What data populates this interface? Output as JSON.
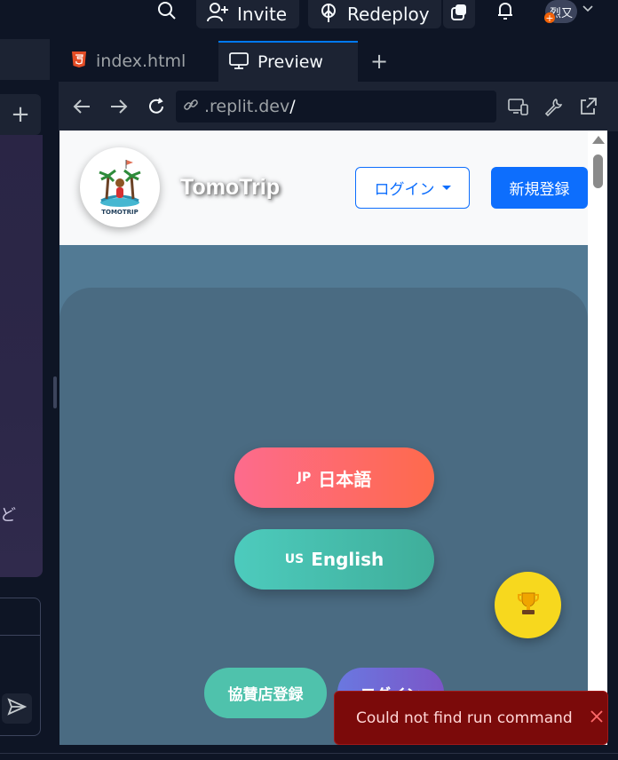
{
  "topbar": {
    "invite_label": "Invite",
    "redeploy_label": "Redeploy",
    "avatar_text": "烈又"
  },
  "sidebar": {
    "chat_snippet": "ど"
  },
  "tabs": [
    {
      "label": "index.html",
      "icon": "html5-icon"
    },
    {
      "label": "Preview",
      "icon": "monitor-icon"
    }
  ],
  "urlbar": {
    "url": ".replit.dev",
    "cursor": "/"
  },
  "site": {
    "brand": "TomoTrip",
    "logo_text": "TOMOTRIP",
    "login_dropdown": "ログイン",
    "signup": "新規登録",
    "lang_jp_code": "JP",
    "lang_jp_label": "日本語",
    "lang_en_code": "US",
    "lang_en_label": "English",
    "sponsor_register": "協賛店登録",
    "login_button": "ログイン"
  },
  "toast": {
    "message": "Could not find run command"
  },
  "colors": {
    "accent": "#0079f2",
    "primary_button": "#0d6efd",
    "toast_bg": "#7b0a0a",
    "trophy_bg": "#f7d81e"
  }
}
